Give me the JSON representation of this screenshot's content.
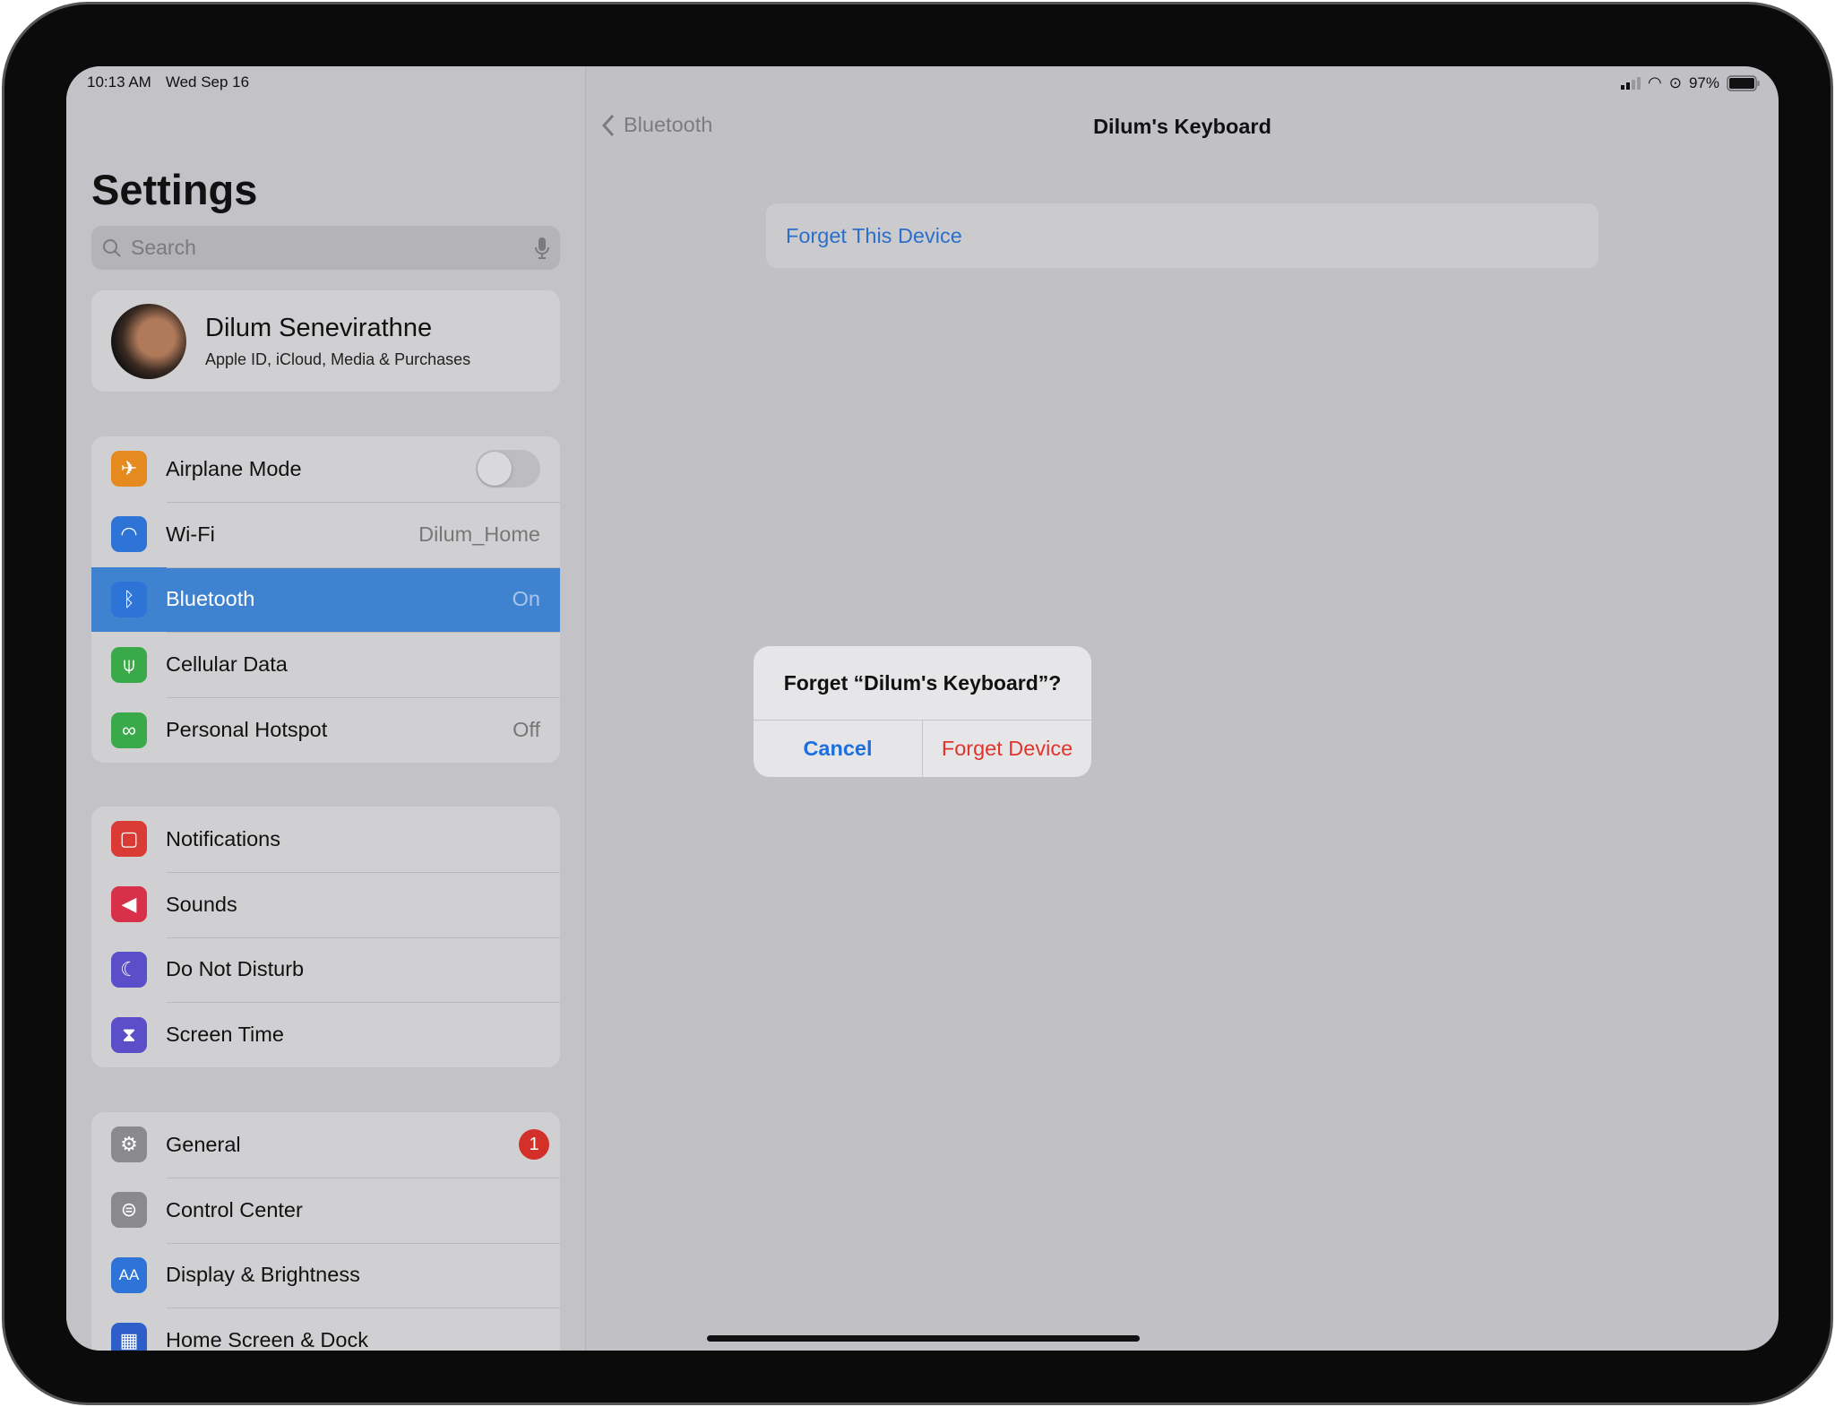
{
  "status": {
    "time": "10:13 AM",
    "date": "Wed Sep 16",
    "battery": "97%"
  },
  "sidebar": {
    "title": "Settings",
    "search_placeholder": "Search",
    "profile": {
      "name": "Dilum Senevirathne",
      "subtitle": "Apple ID, iCloud, Media & Purchases"
    },
    "groups": [
      [
        {
          "label": "Airplane Mode",
          "icon": "airplane-icon",
          "color": "#e58a1f",
          "toggle": false
        },
        {
          "label": "Wi-Fi",
          "value": "Dilum_Home",
          "icon": "wifi-icon",
          "color": "#2e74d6"
        },
        {
          "label": "Bluetooth",
          "value": "On",
          "icon": "bluetooth-icon",
          "color": "#2e74d6",
          "selected": true
        },
        {
          "label": "Cellular Data",
          "icon": "antenna-icon",
          "color": "#3aa94a"
        },
        {
          "label": "Personal Hotspot",
          "value": "Off",
          "icon": "hotspot-icon",
          "color": "#3aa94a"
        }
      ],
      [
        {
          "label": "Notifications",
          "icon": "notifications-icon",
          "color": "#d93a33"
        },
        {
          "label": "Sounds",
          "icon": "speaker-icon",
          "color": "#d9304a"
        },
        {
          "label": "Do Not Disturb",
          "icon": "moon-icon",
          "color": "#5a4fc8"
        },
        {
          "label": "Screen Time",
          "icon": "hourglass-icon",
          "color": "#5a4fc8"
        }
      ],
      [
        {
          "label": "General",
          "icon": "gear-icon",
          "color": "#8a8a8e",
          "badge": "1"
        },
        {
          "label": "Control Center",
          "icon": "switches-icon",
          "color": "#8a8a8e"
        },
        {
          "label": "Display & Brightness",
          "icon": "text-size-icon",
          "color": "#2e74d6"
        },
        {
          "label": "Home Screen & Dock",
          "icon": "grid-icon",
          "color": "#2e5fc8"
        }
      ]
    ]
  },
  "detail": {
    "back": "Bluetooth",
    "title": "Dilum's Keyboard",
    "forget": "Forget This Device"
  },
  "dialog": {
    "title": "Forget “Dilum's Keyboard”?",
    "cancel": "Cancel",
    "confirm": "Forget Device"
  }
}
